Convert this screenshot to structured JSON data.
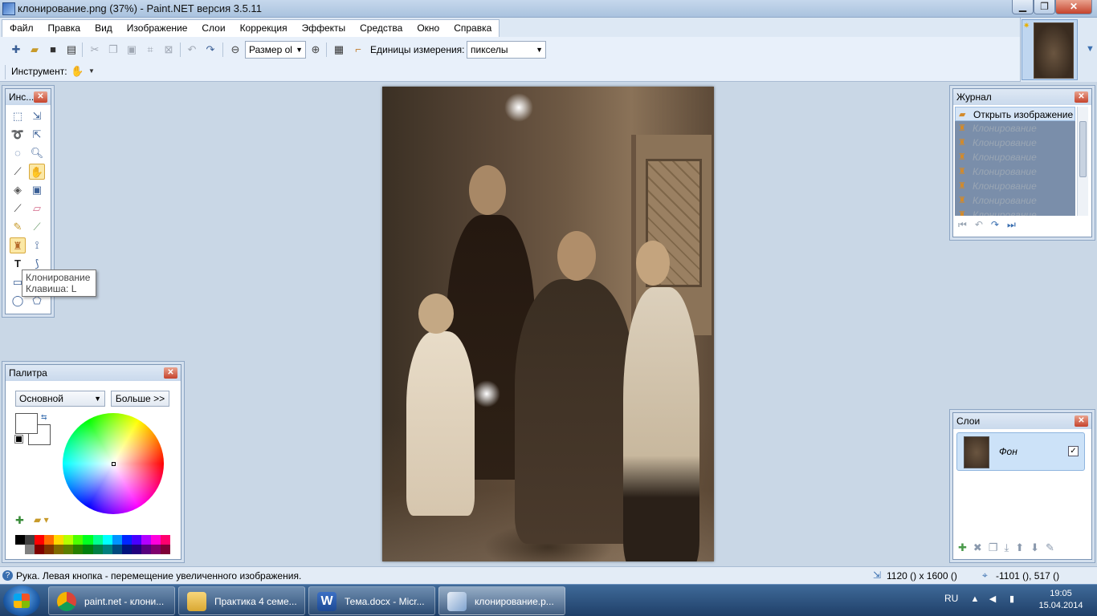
{
  "window": {
    "title": "клонирование.png (37%) - Paint.NET версия 3.5.11",
    "minimize_glyph": "▁",
    "maximize_glyph": "❐",
    "close_glyph": "✕"
  },
  "menu": [
    "Файл",
    "Правка",
    "Вид",
    "Изображение",
    "Слои",
    "Коррекция",
    "Эффекты",
    "Средства",
    "Окно",
    "Справка"
  ],
  "toolbar": {
    "zoom_combo": "Размер ol",
    "units_label": "Единицы измерения:",
    "units_value": "пикселы",
    "tool_label": "Инструмент:"
  },
  "tools_panel": {
    "title": "Инс...",
    "tooltip_title": "Клонирование",
    "tooltip_key": "Клавиша: L"
  },
  "palette_panel": {
    "title": "Палитра",
    "mode": "Основной",
    "more_button": "Больше >>",
    "primary_color": "#ffffff",
    "secondary_color": "#ffffff",
    "colors_top": [
      "#000000",
      "#404040",
      "#ff0000",
      "#ff6a00",
      "#ffd800",
      "#b6ff00",
      "#4cff00",
      "#00ff21",
      "#00ff90",
      "#00ffff",
      "#0094ff",
      "#0026ff",
      "#4800ff",
      "#b200ff",
      "#ff00dc",
      "#ff006e"
    ],
    "colors_bottom": [
      "#ffffff",
      "#808080",
      "#7f0000",
      "#7f3300",
      "#7f6a00",
      "#5b7f00",
      "#267f00",
      "#007f0e",
      "#007f46",
      "#007f7f",
      "#004a7f",
      "#00137f",
      "#21007f",
      "#57007f",
      "#7f006e",
      "#7f0037"
    ]
  },
  "history_panel": {
    "title": "Журнал",
    "items": [
      "Открыть изображение",
      "Клонирование",
      "Клонирование",
      "Клонирование",
      "Клонирование",
      "Клонирование",
      "Клонирование",
      "Клонирование"
    ]
  },
  "layers_panel": {
    "title": "Слои",
    "layer_name": "Фон",
    "layer_visible": "✓"
  },
  "status": {
    "message": "Рука. Левая кнопка - перемещение увеличенного изображения.",
    "image_size": "1120 () x 1600 ()",
    "cursor_pos": "-1101 (), 517 ()"
  },
  "taskbar": {
    "tasks": [
      "paint.net - клони...",
      "Практика 4 семе...",
      "Тема.docx - Micr...",
      "клонирование.p..."
    ],
    "language": "RU",
    "time": "19:05",
    "date": "15.04.2014"
  }
}
